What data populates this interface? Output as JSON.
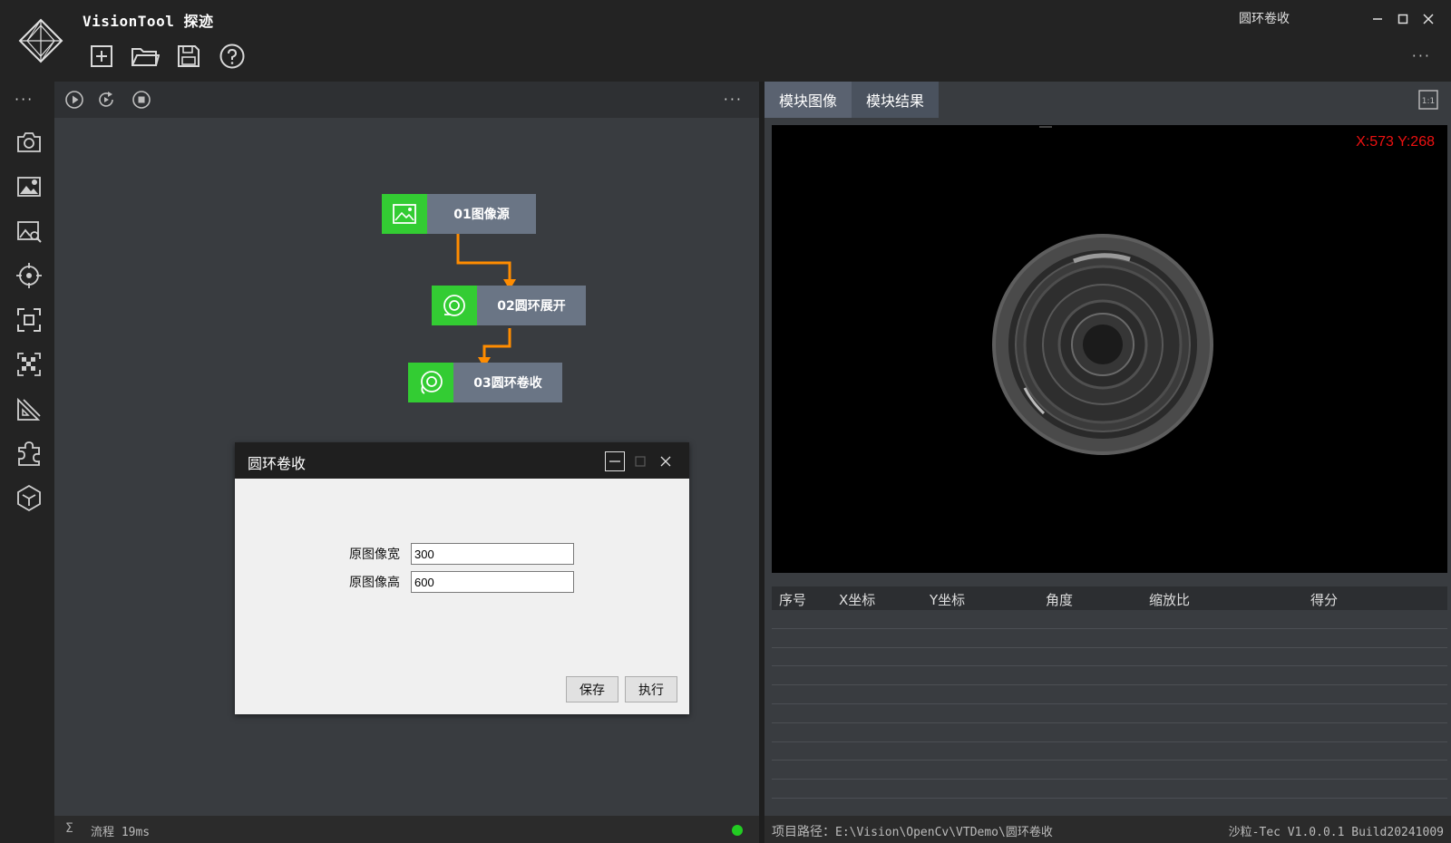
{
  "app": {
    "title": "VisionTool 探迹",
    "window_caption": "圆环卷收"
  },
  "toolbar": {
    "items": [
      {
        "icon": "new-file-icon"
      },
      {
        "icon": "open-folder-icon"
      },
      {
        "icon": "save-icon"
      },
      {
        "icon": "help-icon"
      }
    ],
    "more": "···"
  },
  "sidebar": {
    "more": "···",
    "items": [
      {
        "icon": "camera-icon"
      },
      {
        "icon": "image-settings-icon"
      },
      {
        "icon": "image-search-icon"
      },
      {
        "icon": "target-icon"
      },
      {
        "icon": "focus-frame-icon"
      },
      {
        "icon": "checkerboard-icon"
      },
      {
        "icon": "ruler-icon"
      },
      {
        "icon": "puzzle-icon"
      },
      {
        "icon": "cube-icon"
      }
    ]
  },
  "flow": {
    "toolbar_more": "···",
    "nodes": [
      {
        "label": "01图像源",
        "icon": "image-icon"
      },
      {
        "label": "02圆环展开",
        "icon": "ring-icon"
      },
      {
        "label": "03圆环卷收",
        "icon": "ring-roll-icon"
      }
    ],
    "status": {
      "symbol": "Σ",
      "text": "流程 19ms",
      "indicator_color": "#22cc22"
    },
    "node_color": "#33cc33",
    "connector_color": "#ff8c00"
  },
  "modal": {
    "title": "圆环卷收",
    "fields": [
      {
        "label": "原图像宽",
        "value": "300"
      },
      {
        "label": "原图像高",
        "value": "600"
      }
    ],
    "buttons": {
      "save": "保存",
      "execute": "执行"
    }
  },
  "right_panel": {
    "tabs": [
      {
        "label": "模块图像"
      },
      {
        "label": "模块结果"
      }
    ],
    "ratio_label": "1:1",
    "coords": "X:573 Y:268",
    "coords_color": "#ee1111",
    "table": {
      "headers": [
        "序号",
        "X坐标",
        "Y坐标",
        "角度",
        "缩放比",
        "得分"
      ],
      "rows": []
    },
    "status": {
      "path_label": "项目路径：",
      "path_value": "E:\\Vision\\OpenCv\\VTDemo\\圆环卷收",
      "version": "沙粒-Tec V1.0.0.1 Build20241009"
    }
  }
}
